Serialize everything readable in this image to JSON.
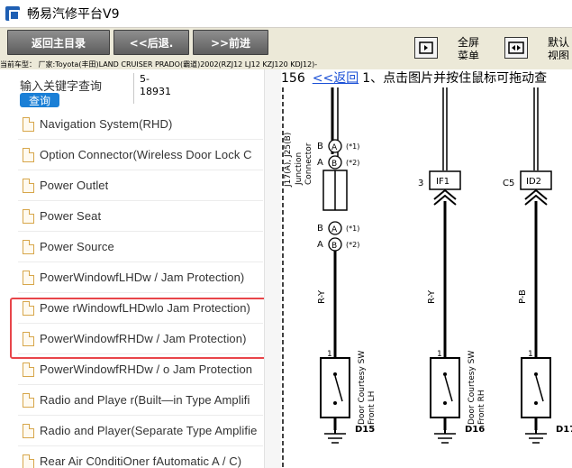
{
  "window": {
    "title": "畅易汽修平台V9"
  },
  "toolbar": {
    "back_main": "返回主目录",
    "back": "<<后退.",
    "forward": ">>前进",
    "fullscreen_line1": "全屏",
    "fullscreen_line2": "菜单",
    "default_line1": "默认",
    "default_line2": "视图"
  },
  "breadcrumb": "当前车型：  厂家:Toyota(丰田)LAND CRUISER PRADO(霸道)2002(RZJ12 LJ12 KZJ120 KDJ12)-",
  "search": {
    "label": "输入关键字查询",
    "value": "5-\n18931",
    "button": "查询"
  },
  "tree": {
    "items": [
      {
        "label": "Navigation System(RHD)"
      },
      {
        "label": "Option Connector(Wireless Door Lock C"
      },
      {
        "label": "Power Outlet"
      },
      {
        "label": "Power Seat"
      },
      {
        "label": "Power Source"
      },
      {
        "label": "PowerWindowfLHDw / Jam Protection)"
      },
      {
        "label": "Powe rWindowfLHDwlo Jam Protection)"
      },
      {
        "label": "PowerWindowfRHDw / Jam Protection)"
      },
      {
        "label": "PowerWindowfRHDw / o Jam Protection"
      },
      {
        "label": "Radio and Playe r(Built—in Type Amplifi"
      },
      {
        "label": "Radio and Player(Separate Type Amplifie"
      },
      {
        "label": "Rear Air C0nditiOner fAutomatic A / C)"
      }
    ]
  },
  "viewer": {
    "page_number": "156",
    "back_link": "<<返回",
    "instruction": "1、点击图片并按住鼠标可拖动查"
  },
  "diagram": {
    "connector_side": "J17(A), J25(B)",
    "connector_name_1": "Junction",
    "connector_name_2": "Connector",
    "pin_b": "B",
    "pin_a": "A",
    "pin_a_note": "(*1)",
    "pin_b_note": "(*2)",
    "wire_ry": "R-Y",
    "wire_pb": "P-B",
    "conn_if1": "IF1",
    "conn_id2": "ID2",
    "conn_3": "3",
    "conn_c5": "C5",
    "pin_1": "1",
    "d15": "D15",
    "d15_desc_1": "Door Courtesy SW",
    "d15_desc_2": "Front LH",
    "d16": "D16",
    "d16_desc_1": "Door Courtesy SW",
    "d16_desc_2": "Front RH",
    "d17": "D17"
  },
  "colors": {
    "toolbar_bg": "#ece9d8",
    "button_gray": "#6e6e6e",
    "search_button": "#1a7fd6",
    "highlight": "#e8454a",
    "link": "#1a4fd6"
  }
}
